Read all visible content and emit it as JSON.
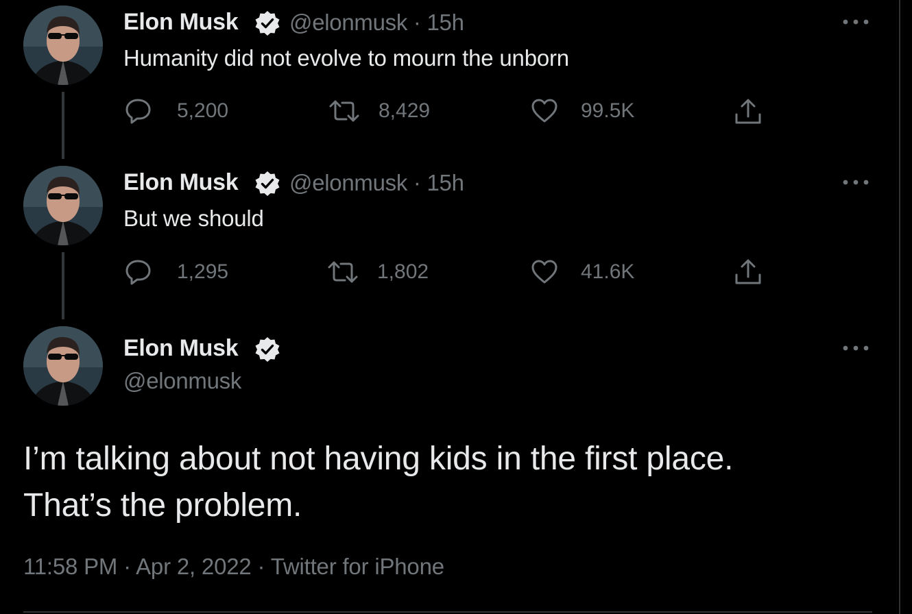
{
  "tweets": [
    {
      "author": {
        "name": "Elon Musk",
        "handle": "@elonmusk",
        "verified": true
      },
      "time": "15h",
      "text": "Humanity did not evolve to mourn the unborn",
      "stats": {
        "replies": "5,200",
        "retweets": "8,429",
        "likes": "99.5K"
      }
    },
    {
      "author": {
        "name": "Elon Musk",
        "handle": "@elonmusk",
        "verified": true
      },
      "time": "15h",
      "text": "But we should",
      "stats": {
        "replies": "1,295",
        "retweets": "1,802",
        "likes": "41.6K"
      }
    }
  ],
  "main_tweet": {
    "author": {
      "name": "Elon Musk",
      "handle": "@elonmusk",
      "verified": true
    },
    "text_lines": [
      "I’m talking about not having kids in the first place.",
      "That’s the problem."
    ],
    "time": "11:58 PM",
    "date": "Apr 2, 2022",
    "source": "Twitter for iPhone"
  },
  "separator": "·",
  "icons": {
    "reply": "reply-bubble-icon",
    "retweet": "retweet-arrows-icon",
    "like": "heart-outline-icon",
    "share": "share-upload-icon",
    "more": "more-dots-icon",
    "verified": "verified-badge-icon"
  },
  "colors": {
    "background": "#000000",
    "text_primary": "#e7e9ea",
    "text_secondary": "#71767b",
    "thread_line": "#333639",
    "border": "#2f3336"
  }
}
